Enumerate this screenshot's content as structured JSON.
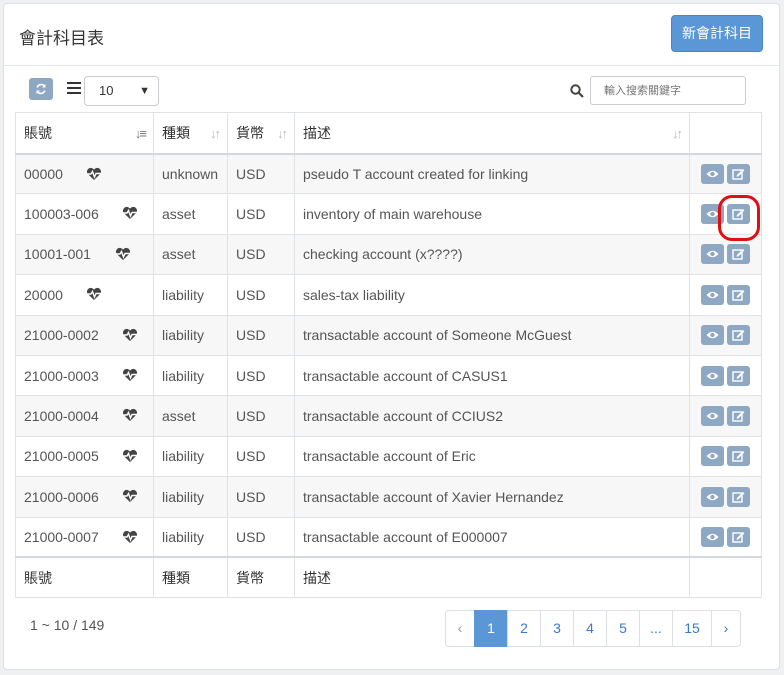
{
  "header": {
    "title": "會計科目表",
    "new_button_label": "新會計科目"
  },
  "toolbar": {
    "page_size": "10",
    "search_placeholder": "輸入搜索關鍵字"
  },
  "table": {
    "columns": [
      "賬號",
      "種類",
      "貨幣",
      "描述"
    ],
    "rows": [
      {
        "account": "00000",
        "type": "unknown",
        "currency": "USD",
        "description": "pseudo T account created for linking"
      },
      {
        "account": "100003-006",
        "type": "asset",
        "currency": "USD",
        "description": "inventory of main warehouse"
      },
      {
        "account": "10001-001",
        "type": "asset",
        "currency": "USD",
        "description": "checking account (x????)"
      },
      {
        "account": "20000",
        "type": "liability",
        "currency": "USD",
        "description": "sales-tax liability"
      },
      {
        "account": "21000-0002",
        "type": "liability",
        "currency": "USD",
        "description": "transactable account of Someone McGuest"
      },
      {
        "account": "21000-0003",
        "type": "liability",
        "currency": "USD",
        "description": "transactable account of CASUS1"
      },
      {
        "account": "21000-0004",
        "type": "asset",
        "currency": "USD",
        "description": "transactable account of CCIUS2"
      },
      {
        "account": "21000-0005",
        "type": "liability",
        "currency": "USD",
        "description": "transactable account of Eric"
      },
      {
        "account": "21000-0006",
        "type": "liability",
        "currency": "USD",
        "description": "transactable account of Xavier Hernandez"
      },
      {
        "account": "21000-0007",
        "type": "liability",
        "currency": "USD",
        "description": "transactable account of E000007"
      }
    ]
  },
  "footer": {
    "range_text": "1 ~ 10 / 149",
    "pages": [
      "‹",
      "1",
      "2",
      "3",
      "4",
      "5",
      "...",
      "15",
      "›"
    ],
    "active_page": "1"
  },
  "colors": {
    "accent": "#5b96d6",
    "action_button": "#8ea8c4",
    "highlight": "#e01010"
  }
}
